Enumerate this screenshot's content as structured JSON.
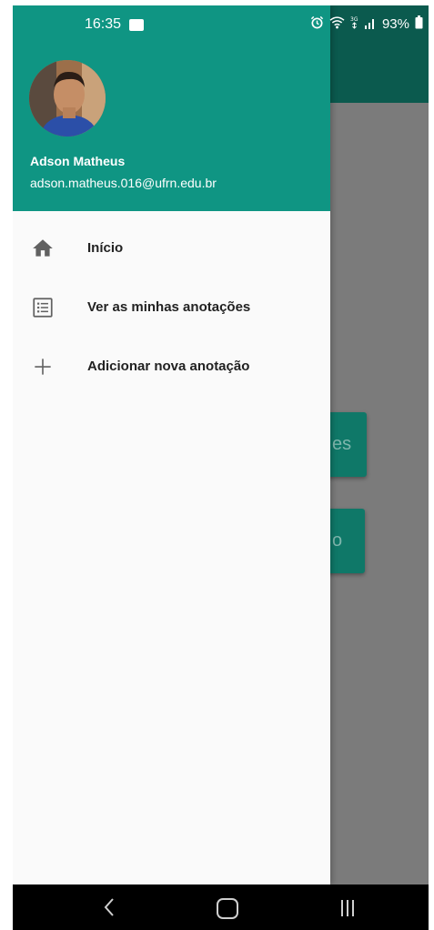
{
  "status_bar": {
    "time": "16:35",
    "battery": "93%"
  },
  "background_app": {
    "button1_text": "es",
    "button2_text": "o"
  },
  "drawer": {
    "account_name": "Adson Matheus",
    "account_email": "adson.matheus.016@ufrn.edu.br",
    "items": [
      {
        "label": "Início",
        "icon": "home-icon"
      },
      {
        "label": "Ver as minhas anotações",
        "icon": "list-icon"
      },
      {
        "label": "Adicionar nova anotação",
        "icon": "plus-icon"
      }
    ]
  },
  "colors": {
    "drawer_header": "#0f9583",
    "app_bar": "#0b5a4e",
    "scrim": "#7b7b7b"
  }
}
